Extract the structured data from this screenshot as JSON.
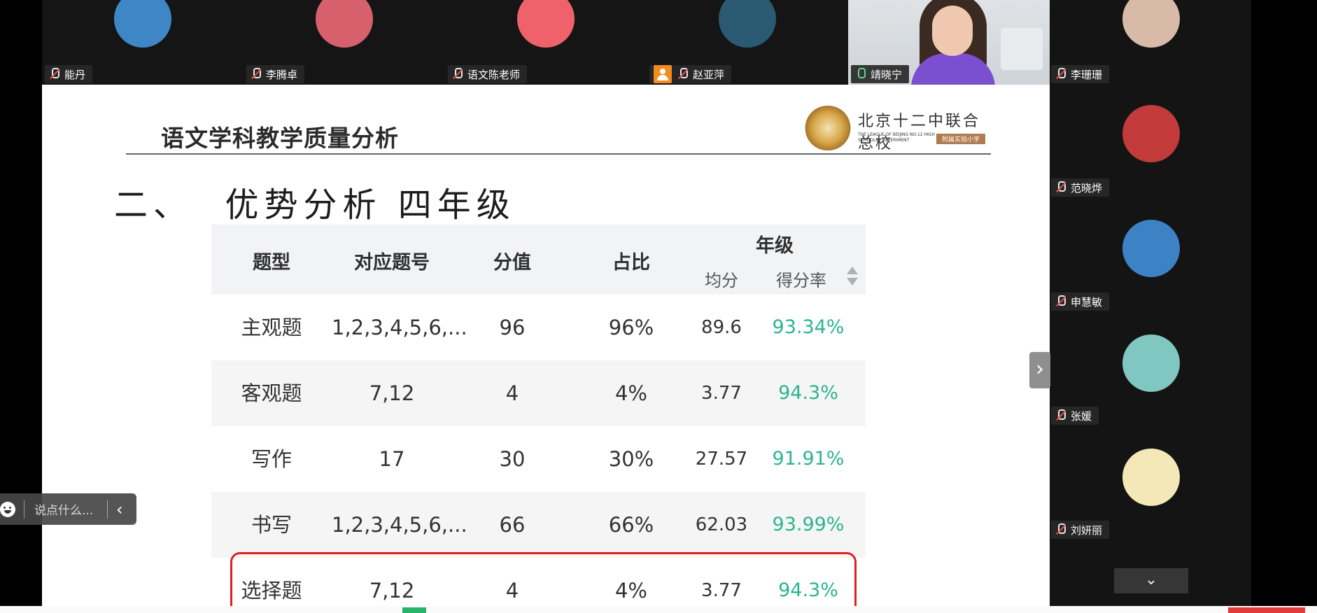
{
  "top_participants": [
    {
      "name": "能丹",
      "mic": "muted",
      "avatar_color": "#3f86c6"
    },
    {
      "name": "李腾卓",
      "mic": "muted",
      "avatar_color": "#d6606b"
    },
    {
      "name": "语文陈老师",
      "mic": "muted",
      "avatar_color": "#f0626b"
    },
    {
      "name": "赵亚萍",
      "mic": "no-camera",
      "avatar_color": "#2a5a72"
    },
    {
      "name": "靖晓宁",
      "mic": "on",
      "video": true
    }
  ],
  "right_participants": [
    {
      "name": "李珊珊",
      "mic": "muted",
      "avatar_color": "#d9b9a8"
    },
    {
      "name": "范晓烨",
      "mic": "muted",
      "avatar_color": "#c23a3a"
    },
    {
      "name": "申慧敏",
      "mic": "muted",
      "avatar_color": "#3d82c4"
    },
    {
      "name": "张媛",
      "mic": "muted",
      "avatar_color": "#7fc7c0"
    },
    {
      "name": "刘妍丽",
      "mic": "muted",
      "avatar_color": "#f4e7b8"
    }
  ],
  "slide": {
    "title": "语文学科教学质量分析",
    "subtitle": "二、  优势分析 四年级",
    "logo": {
      "cn_text": "北京十二中联合总校",
      "en_text": "THE LEAGUE OF BEIJING NO.12 HIGH SCHOOLS · EXPERIMENT",
      "badge": "附属实验小学"
    },
    "table": {
      "headers": [
        "题型",
        "对应题号",
        "分值",
        "占比"
      ],
      "group_header": "年级",
      "sub_headers": [
        "均分",
        "得分率"
      ],
      "rows": [
        {
          "type": "主观题",
          "questions": "1,2,3,4,5,6,...",
          "score": "96",
          "ratio": "96%",
          "avg": "89.6",
          "rate": "93.34%"
        },
        {
          "type": "客观题",
          "questions": "7,12",
          "score": "4",
          "ratio": "4%",
          "avg": "3.77",
          "rate": "94.3%"
        },
        {
          "type": "写作",
          "questions": "17",
          "score": "30",
          "ratio": "30%",
          "avg": "27.57",
          "rate": "91.91%"
        },
        {
          "type": "书写",
          "questions": "1,2,3,4,5,6,...",
          "score": "66",
          "ratio": "66%",
          "avg": "62.03",
          "rate": "93.99%"
        },
        {
          "type": "选择题",
          "questions": "7,12",
          "score": "4",
          "ratio": "4%",
          "avg": "3.77",
          "rate": "94.3%"
        }
      ]
    }
  },
  "chat": {
    "placeholder": "说点什么..."
  },
  "icons": {
    "next": "chevron-right-icon",
    "collapse": "chevron-left-icon",
    "scroll": "chevron-down-icon",
    "emoji": "emoji-icon",
    "sort": "sort-icon",
    "mic": "mic-muted-icon"
  },
  "colors": {
    "rate_text": "#2bb58f",
    "highlight": "#e02020",
    "muted_mic": "#e34d4d"
  }
}
